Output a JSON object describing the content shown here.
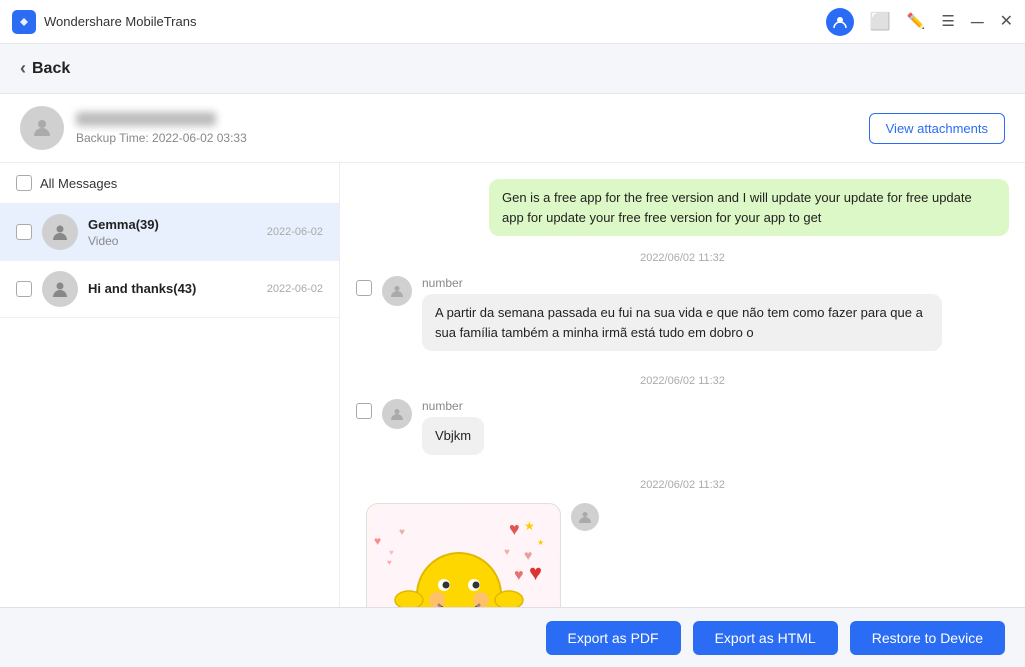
{
  "app": {
    "title": "Wondershare MobileTrans",
    "logo_alt": "MobileTrans logo"
  },
  "titlebar": {
    "controls": [
      "account",
      "window",
      "edit",
      "menu",
      "minimize",
      "close"
    ]
  },
  "back_button": {
    "label": "Back"
  },
  "profile": {
    "name_blurred": true,
    "backup_time_label": "Backup Time: 2022-06-02 03:33",
    "view_attachments_label": "View attachments"
  },
  "left_panel": {
    "all_messages_label": "All Messages",
    "conversations": [
      {
        "name": "Gemma(39)",
        "preview": "Video",
        "date": "2022-06-02",
        "selected": true
      },
      {
        "name": "Hi and thanks(43)",
        "preview": "",
        "date": "2022-06-02",
        "selected": false
      }
    ]
  },
  "right_panel": {
    "outgoing_message": {
      "text": "Gen is a free app for the free version and I will update your update for free update app for update your free free version for your app to get"
    },
    "messages": [
      {
        "timestamp": "2022/06/02 11:32",
        "sender": "number",
        "text": "A partir da semana passada eu fui na sua vida e que não tem como fazer para que a sua família também a minha irmã está tudo em dobro o"
      },
      {
        "timestamp": "2022/06/02 11:32",
        "sender": "number",
        "text": "Vbjkm"
      },
      {
        "timestamp": "2022/06/02 11:32",
        "sender": null,
        "is_sticker": true
      }
    ]
  },
  "action_bar": {
    "export_pdf_label": "Export as PDF",
    "export_html_label": "Export as HTML",
    "restore_label": "Restore to Device"
  }
}
